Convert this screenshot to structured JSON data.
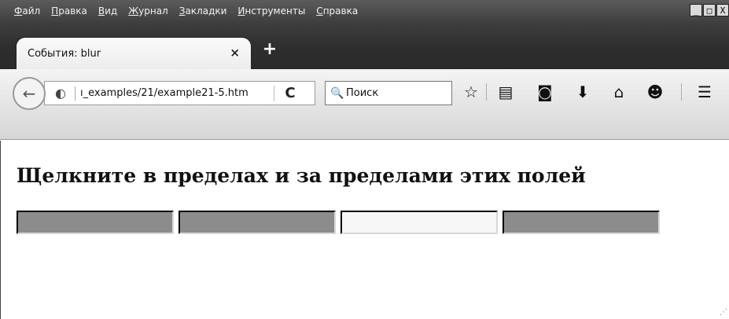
{
  "menu": [
    {
      "label": "Файл"
    },
    {
      "label": "Правка"
    },
    {
      "label": "Вид"
    },
    {
      "label": "Журнал"
    },
    {
      "label": "Закладки"
    },
    {
      "label": "Инструменты"
    },
    {
      "label": "Справка"
    }
  ],
  "window_controls": {
    "minimize": "_",
    "maximize": "□",
    "close": "X"
  },
  "tab": {
    "title": "События: blur",
    "close": "×"
  },
  "new_tab": "+",
  "nav": {
    "back": "←",
    "globe": "◐",
    "url": "ı_examples/21/example21-5.htm",
    "reload": "C",
    "search_icon": "🔍",
    "search_placeholder": "Поиск"
  },
  "toolbar_icons": {
    "bookmark_star": "☆",
    "reading_list": "▤",
    "pocket": "◙",
    "downloads": "⬇",
    "home": "⌂",
    "hello": "☻",
    "menu": "☰"
  },
  "page": {
    "heading": "Щелкните в пределах и за пределами этих полей",
    "fields": [
      {
        "value": "",
        "state": "blurred"
      },
      {
        "value": "",
        "state": "blurred"
      },
      {
        "value": "",
        "state": "focused"
      },
      {
        "value": "",
        "state": "blurred"
      }
    ]
  },
  "colors": {
    "chrome_dark": "#2e2e2e",
    "blurred_field": "#8c8c8c",
    "focused_field": "#f7f7f7"
  }
}
